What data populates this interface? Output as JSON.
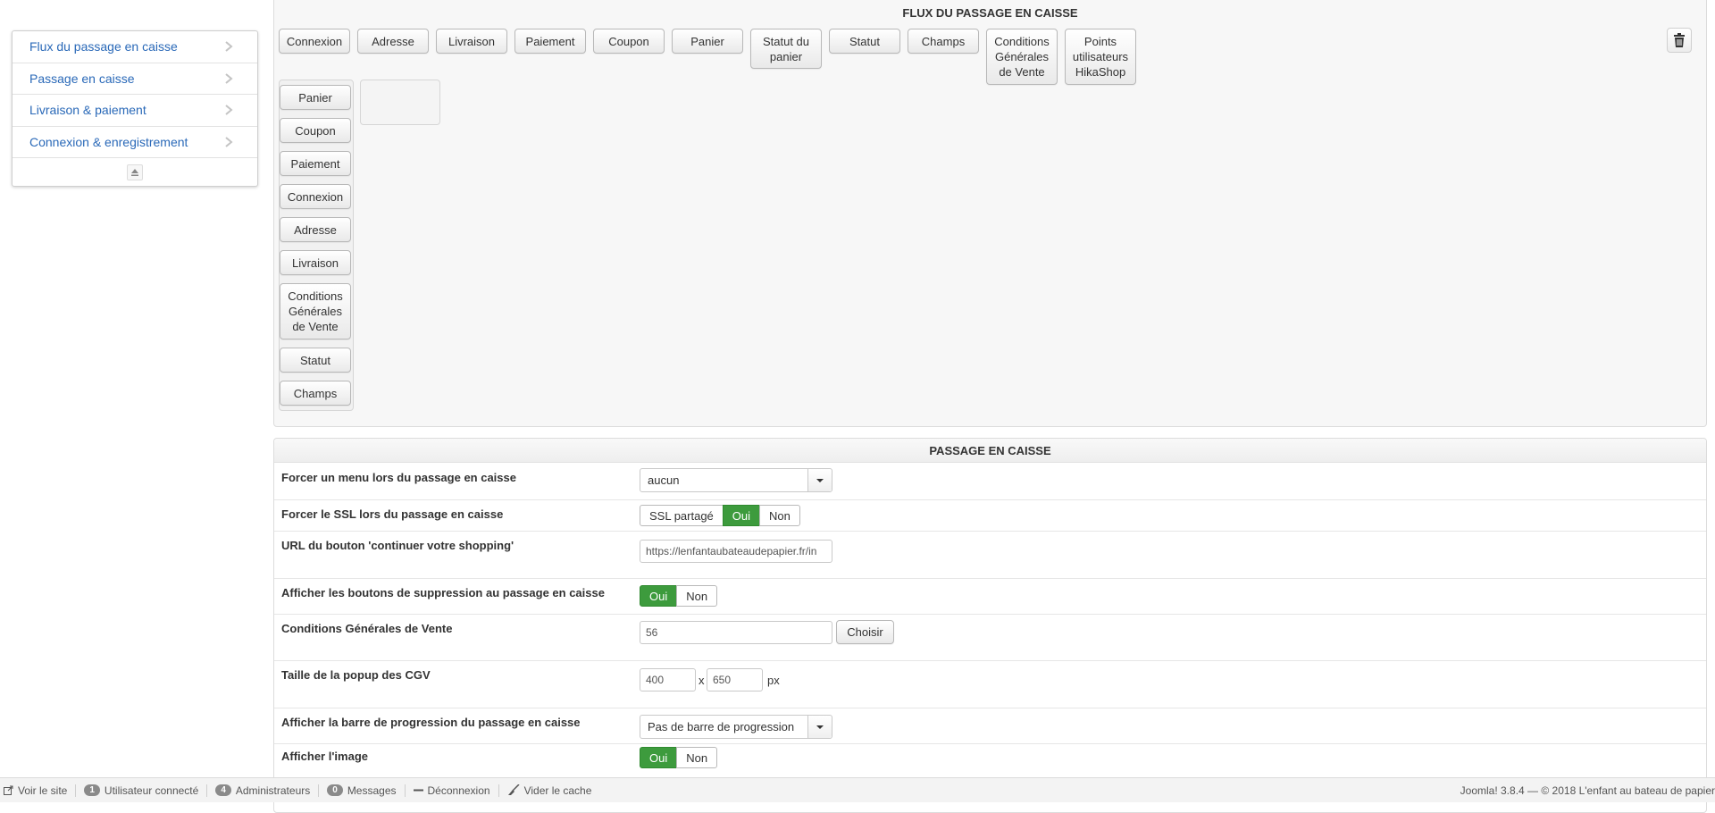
{
  "sidebar": {
    "items": [
      {
        "label": "Flux du passage en caisse"
      },
      {
        "label": "Passage en caisse"
      },
      {
        "label": "Livraison & paiement"
      },
      {
        "label": "Connexion & enregistrement"
      }
    ]
  },
  "flux": {
    "title": "FLUX DU PASSAGE EN CAISSE",
    "top_buttons": [
      "Connexion",
      "Adresse",
      "Livraison",
      "Paiement",
      "Coupon",
      "Panier",
      "Statut du panier",
      "Statut",
      "Champs",
      "Conditions Générales de Vente",
      "Points utilisateurs HikaShop"
    ],
    "step_buttons": [
      "Panier",
      "Coupon",
      "Paiement",
      "Connexion",
      "Adresse",
      "Livraison",
      "Conditions Générales de Vente",
      "Statut",
      "Champs"
    ]
  },
  "passage": {
    "title": "PASSAGE EN CAISSE",
    "rows": {
      "force_menu": {
        "label": "Forcer un menu lors du passage en caisse",
        "value": "aucun"
      },
      "force_ssl": {
        "label": "Forcer le SSL lors du passage en caisse",
        "options": [
          "SSL partagé",
          "Oui",
          "Non"
        ],
        "selected": "Oui"
      },
      "continue_url": {
        "label": "URL du bouton 'continuer votre shopping'",
        "value": "https://lenfantaubateaudepapier.fr/in"
      },
      "delete_buttons": {
        "label": "Afficher les boutons de suppression au passage en caisse",
        "options": [
          "Oui",
          "Non"
        ],
        "selected": "Oui"
      },
      "cgv": {
        "label": "Conditions Générales de Vente",
        "value": "56",
        "button": "Choisir"
      },
      "popup_size": {
        "label": "Taille de la popup des CGV",
        "width": "400",
        "separator": "x",
        "height": "650",
        "unit": "px"
      },
      "progress_bar": {
        "label": "Afficher la barre de progression du passage en caisse",
        "value": "Pas de barre de progression"
      },
      "show_image": {
        "label": "Afficher l'image",
        "options": [
          "Oui",
          "Non"
        ],
        "selected": "Oui"
      }
    }
  },
  "statusbar": {
    "view_site": "Voir le site",
    "users_count": "1",
    "users_label": "Utilisateur connecté",
    "admins_count": "4",
    "admins_label": "Administrateurs",
    "messages_count": "0",
    "messages_label": "Messages",
    "logout": "Déconnexion",
    "clear_cache": "Vider le cache",
    "version_info": "Joomla! 3.8.4  —  © 2018 L'enfant au bateau de papier"
  },
  "colors": {
    "accent_green": "#3d9b3d",
    "link_blue": "#2a69b8"
  }
}
